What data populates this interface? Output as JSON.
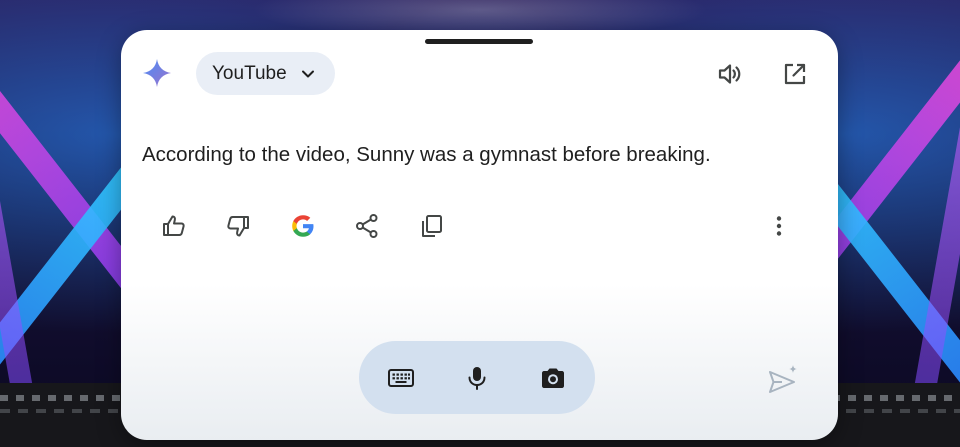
{
  "overlay": {
    "source_chip": {
      "label": "YouTube",
      "icon": "chevron-down-icon"
    },
    "header_icons": [
      "sparkle-icon",
      "speaker-icon",
      "open-external-icon"
    ],
    "answer_text": "According to the video, Sunny was a gymnast before breaking.",
    "actions": [
      "thumbs-up-icon",
      "thumbs-down-icon",
      "google-icon",
      "share-icon",
      "copy-icon",
      "more-vert-icon"
    ],
    "input_bar": [
      "keyboard-icon",
      "microphone-icon",
      "camera-icon"
    ],
    "send_icon": "send-sparkle-icon"
  },
  "colors": {
    "panel_bg": "#ffffff",
    "chip_bg": "#e9eef6",
    "input_bar_bg": "#d3e0ef",
    "icon_dark": "#444746",
    "text": "#1f1f1f",
    "send_disabled": "#a8b4c0"
  }
}
